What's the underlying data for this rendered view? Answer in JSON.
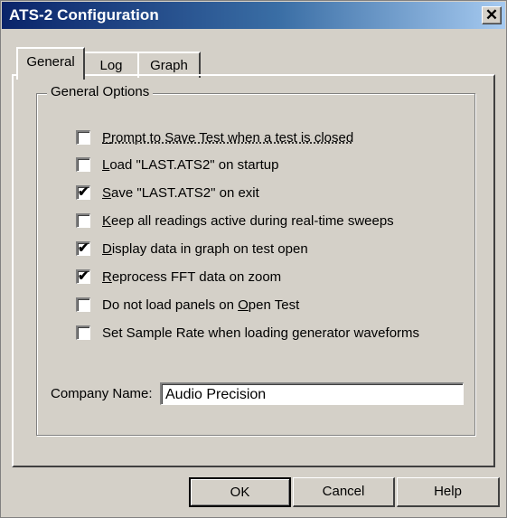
{
  "window": {
    "title": "ATS-2 Configuration",
    "close_glyph": "✕",
    "close_icon": "close-icon"
  },
  "tabs": [
    {
      "label": "General",
      "active": true
    },
    {
      "label": "Log",
      "active": false
    },
    {
      "label": "Graph",
      "active": false
    }
  ],
  "group": {
    "title": "General Options"
  },
  "options": [
    {
      "pre": "",
      "key": "P",
      "post": "rompt to Save Test  when a test is closed",
      "checked": false,
      "underline_all": true,
      "mark": ""
    },
    {
      "pre": "",
      "key": "L",
      "post": "oad \"LAST.ATS2\" on startup",
      "checked": false,
      "mark": ""
    },
    {
      "pre": "",
      "key": "S",
      "post": "ave \"LAST.ATS2\" on exit",
      "checked": true,
      "mark": "✔"
    },
    {
      "pre": "",
      "key": "K",
      "post": "eep all readings active during real-time sweeps",
      "checked": false,
      "mark": ""
    },
    {
      "pre": "",
      "key": "D",
      "post": "isplay data in graph on test open",
      "checked": true,
      "mark": "✔"
    },
    {
      "pre": "",
      "key": "R",
      "post": "eprocess FFT data on zoom",
      "checked": true,
      "mark": "✔"
    },
    {
      "pre": "Do not load panels on ",
      "key": "O",
      "post": "pen Test",
      "checked": false,
      "mark": ""
    },
    {
      "pre": "Set Sample Rate when loading generator waveforms",
      "key": "",
      "post": "",
      "checked": false,
      "mark": ""
    }
  ],
  "company": {
    "label": "Company Name:",
    "value": "Audio Precision"
  },
  "buttons": {
    "ok": "OK",
    "cancel": "Cancel",
    "help": "Help"
  },
  "colors": {
    "face": "#d4d0c8",
    "title_start": "#0a246a",
    "title_end": "#a6caf0"
  }
}
